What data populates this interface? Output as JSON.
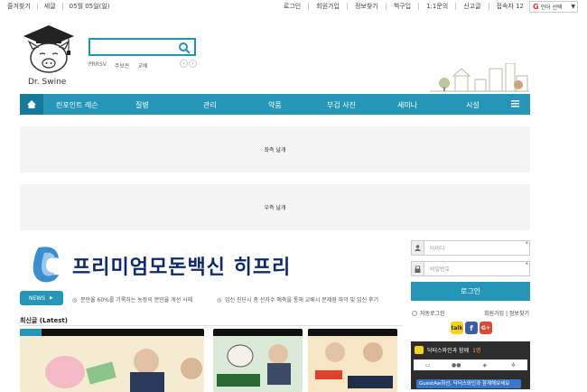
{
  "topbar": {
    "left": [
      "즐겨찾기",
      "세글",
      "05월 05일(일)"
    ],
    "right": [
      "로그인",
      "회원가입",
      "정보찾기",
      "책구입",
      "1:1문의",
      "신고글",
      "접속자 12"
    ],
    "lang": "언어 선택"
  },
  "logo": {
    "text": "Dr. Swine"
  },
  "search": {
    "placeholder": "",
    "keywords": [
      "PRRSV",
      "주보돈",
      "교배"
    ]
  },
  "nav": {
    "items": [
      "린포인트 레슨",
      "질병",
      "관리",
      "약품",
      "부검 사진",
      "세미나",
      "시설"
    ]
  },
  "ads": {
    "left": "좌측 날개",
    "right": "우측 날개"
  },
  "banner": {
    "text": "프리미엄모돈백신 히프리"
  },
  "news": {
    "label": "NEWS",
    "items": [
      "분만율 60%를 기록하는 농장의 분만율 개선 사례",
      "임신 진단시 총 산자수 예측을 통해 교배시 문제점 파악 및 임신 후기"
    ]
  },
  "latest": {
    "title": "최신글 (Latest)"
  },
  "login": {
    "id_placeholder": "아이디",
    "pw_placeholder": "비밀번호",
    "button": "로그인",
    "auto": "자동로그인",
    "links": "회원가입 | 정보찾기"
  },
  "chat": {
    "title": "닥터스와인과 함께",
    "count": "1명",
    "message": "GuestAw하선, 닥터스와인과 함께해보세요"
  },
  "colors": {
    "primary": "#2596b7",
    "dark": "#16799a"
  }
}
